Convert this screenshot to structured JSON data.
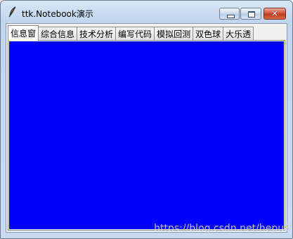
{
  "window": {
    "title": "ttk.Notebook演示",
    "app_icon": "feather-icon",
    "controls": {
      "minimize_icon": "minimize-icon",
      "maximize_icon": "maximize-icon",
      "close_icon": "close-icon",
      "close_glyph": "✕"
    }
  },
  "notebook": {
    "tabs": [
      {
        "label": "信息窗",
        "selected": true
      },
      {
        "label": "综合信息",
        "selected": false
      },
      {
        "label": "技术分析",
        "selected": false
      },
      {
        "label": "编写代码",
        "selected": false
      },
      {
        "label": "模拟回测",
        "selected": false
      },
      {
        "label": "双色球",
        "selected": false
      },
      {
        "label": "大乐透",
        "selected": false
      }
    ],
    "page_background": "#0000ff"
  },
  "watermark": "https://blog.csdn.net/hepu8"
}
